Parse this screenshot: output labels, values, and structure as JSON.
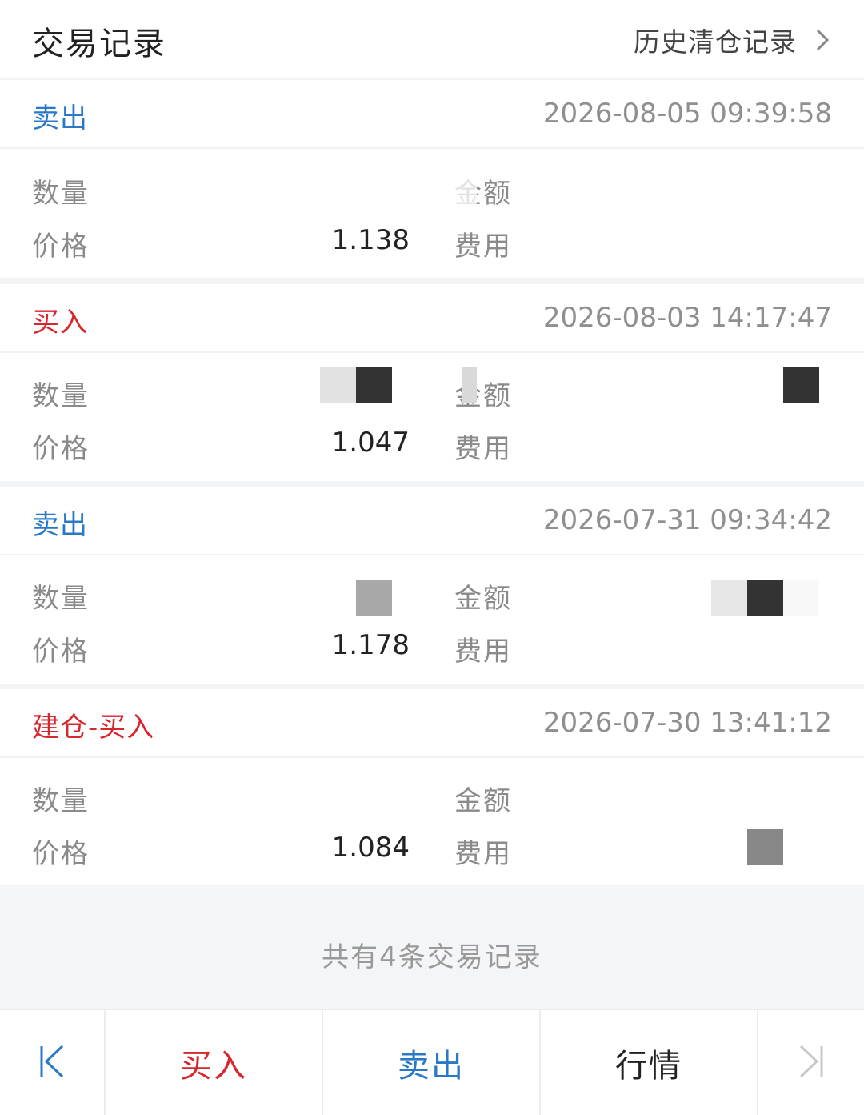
{
  "header": {
    "title": "交易记录",
    "history_link": "历史清仓记录"
  },
  "labels": {
    "quantity": "数量",
    "amount": "金额",
    "price": "价格",
    "fee": "费用"
  },
  "records": [
    {
      "type": "卖出",
      "time": "2026-08-05 09:39:58",
      "price": "1.138"
    },
    {
      "type": "买入",
      "time": "2026-08-03 14:17:47",
      "price": "1.047"
    },
    {
      "type": "卖出",
      "time": "2026-07-31 09:34:42",
      "price": "1.178"
    },
    {
      "type": "建仓-买入",
      "time": "2026-07-30 13:41:12",
      "price": "1.084"
    }
  ],
  "summary": "共有4条交易记录",
  "bottom_bar": {
    "buy": "买入",
    "sell": "卖出",
    "market": "行情"
  },
  "colors": {
    "sell": "#2a79c9",
    "buy": "#d8262d"
  },
  "icons": {
    "history_chevron": "chevron-right-icon",
    "first": "skip-first-icon",
    "last": "skip-last-icon"
  }
}
